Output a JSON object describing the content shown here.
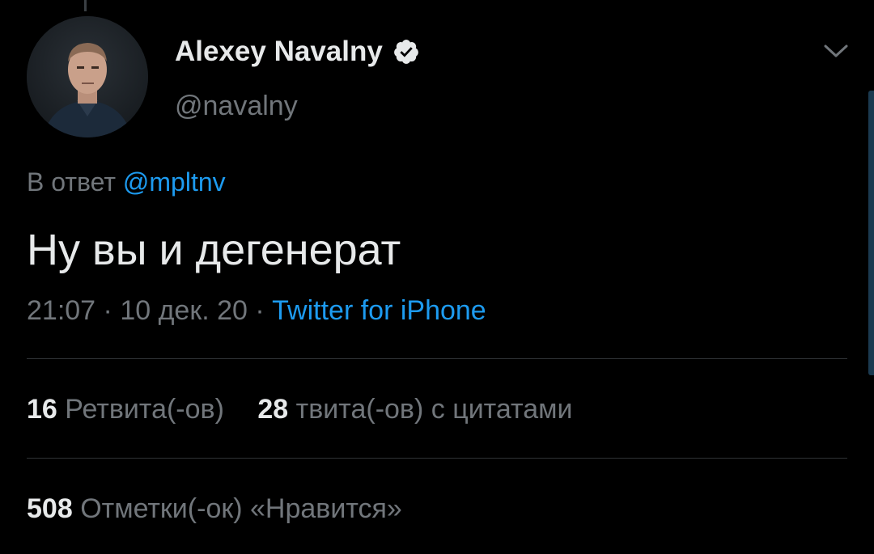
{
  "tweet": {
    "author": {
      "name": "Alexey Navalny",
      "handle": "@navalny",
      "verified": true,
      "avatar_icon": "profile-photo"
    },
    "reply_context": {
      "prefix": "В ответ",
      "mention": "@mpltnv"
    },
    "text": "Ну вы и дегенерат",
    "meta": {
      "time": "21:07",
      "separator": " · ",
      "date": "10 дек. 20",
      "source": "Twitter for iPhone"
    },
    "stats": {
      "retweets": {
        "count": "16",
        "label": "Ретвита(-ов)"
      },
      "quotes": {
        "count": "28",
        "label": "твита(-ов) с цитатами"
      },
      "likes": {
        "count": "508",
        "label": "Отметки(-ок) «Нравится»"
      }
    },
    "menu_icon": "chevron-down-icon"
  },
  "colors": {
    "background": "#000000",
    "text_primary": "#e7e9ea",
    "text_secondary": "#71767b",
    "accent": "#1d9bf0",
    "divider": "#2f3336"
  }
}
